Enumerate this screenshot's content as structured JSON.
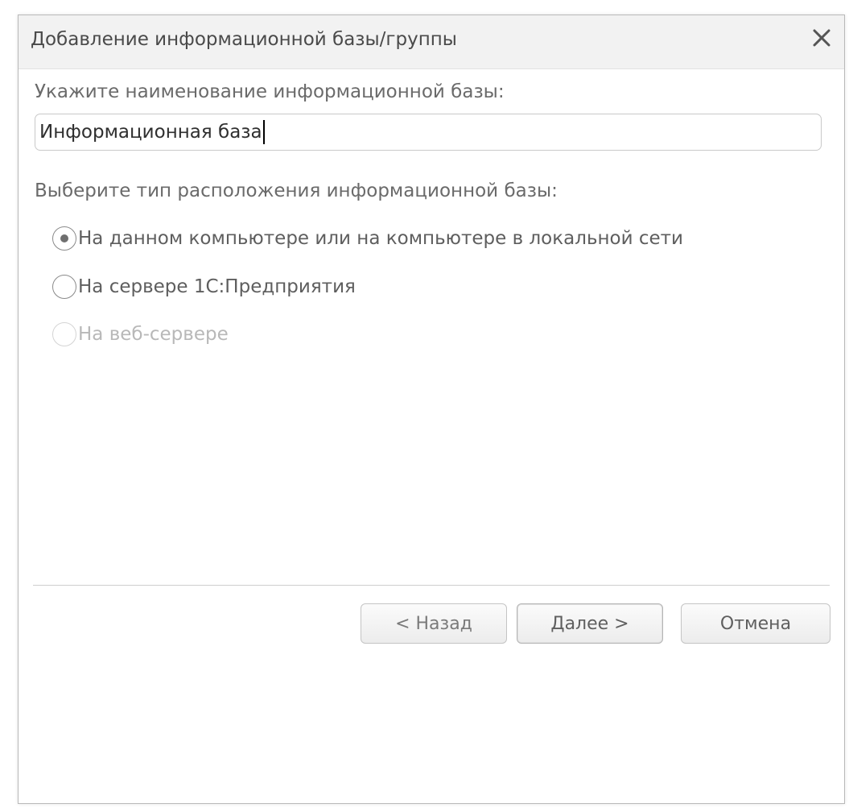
{
  "window": {
    "title": "Добавление информационной базы/группы"
  },
  "name_section": {
    "label": "Укажите наименование информационной базы:",
    "input_value": "Информационная база"
  },
  "location_section": {
    "label": "Выберите тип расположения информационной базы:",
    "options": [
      {
        "label": "На данном компьютере или на компьютере в локальной сети",
        "selected": true,
        "enabled": true
      },
      {
        "label": "На сервере 1С:Предприятия",
        "selected": false,
        "enabled": true
      },
      {
        "label": "На веб-сервере",
        "selected": false,
        "enabled": false
      }
    ]
  },
  "buttons": {
    "back_label": "< Назад",
    "next_label": "Далее >",
    "cancel_label": "Отмена"
  },
  "icons": {
    "close": "close-icon"
  },
  "colors": {
    "title_bar": "#f2f2f2",
    "text": "#5e5e5e",
    "disabled_text": "#b8b8b8"
  }
}
